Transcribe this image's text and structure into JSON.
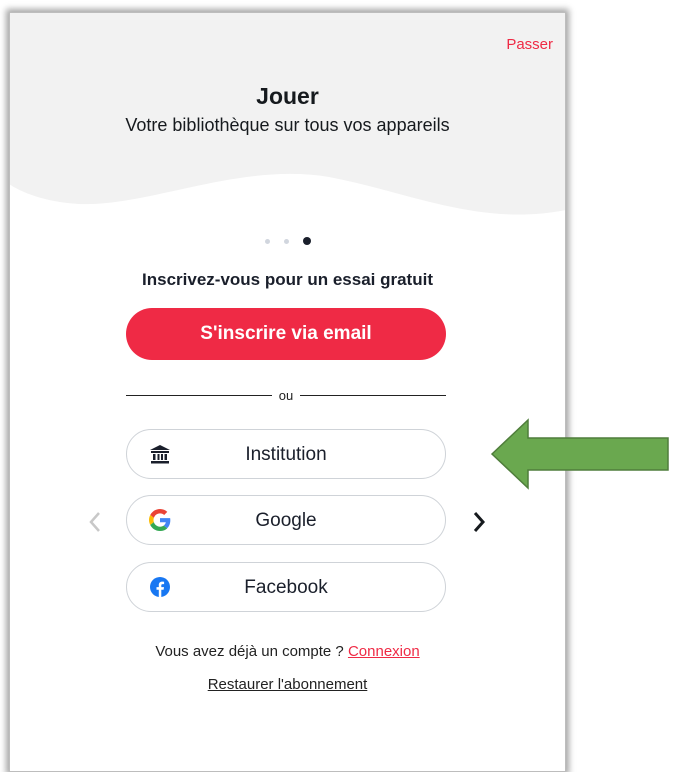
{
  "header": {
    "skip_label": "Passer",
    "title": "Jouer",
    "subtitle": "Votre bibliothèque sur tous vos appareils"
  },
  "pager": {
    "total_pages": 3,
    "active_page": 3
  },
  "signup": {
    "prompt": "Inscrivez-vous pour un essai gratuit",
    "email_button": "S'inscrire via email",
    "divider_text": "ou"
  },
  "social_buttons": [
    {
      "label": "Institution",
      "icon": "institution-icon"
    },
    {
      "label": "Google",
      "icon": "google-icon"
    },
    {
      "label": "Facebook",
      "icon": "facebook-icon"
    }
  ],
  "footer": {
    "have_account_text": "Vous avez déjà un compte ?",
    "login_link": "Connexion",
    "restore_link": "Restaurer l'abonnement"
  },
  "colors": {
    "accent": "#ef2a45",
    "text": "#1a1f2b",
    "hero_bg": "#f2f2f2",
    "annotation_arrow": "#6aa84f"
  }
}
